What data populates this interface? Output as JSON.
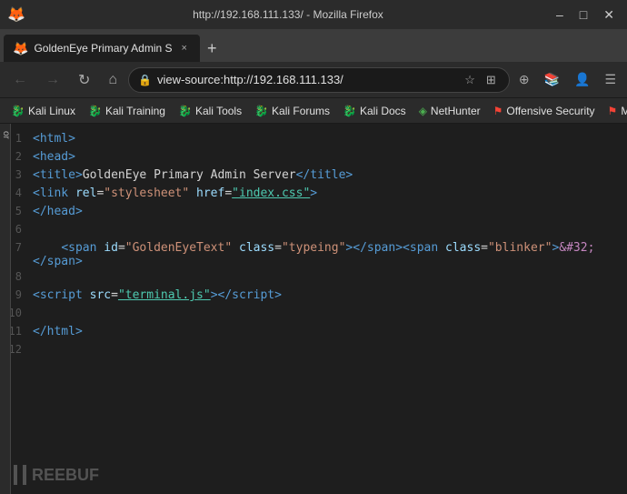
{
  "titlebar": {
    "title": "http://192.168.111.133/ - Mozilla Firefox",
    "controls": [
      "–",
      "□",
      "✕"
    ]
  },
  "tab": {
    "label": "GoldenEye Primary Admin S",
    "url": "http://192.168.111.133/",
    "close": "×"
  },
  "navbar": {
    "url": "view-source:http://192.168.111.133/",
    "lock_icon": "🔒"
  },
  "bookmarks": [
    {
      "label": "Kali Linux",
      "icon": "❊",
      "class": "bookmark-kali"
    },
    {
      "label": "Kali Training",
      "icon": "❊",
      "class": "bookmark-training"
    },
    {
      "label": "Kali Tools",
      "icon": "❊",
      "class": "bookmark-tools"
    },
    {
      "label": "Kali Forums",
      "icon": "❊",
      "class": "bookmark-forums"
    },
    {
      "label": "Kali Docs",
      "icon": "❊",
      "class": "bookmark-docs"
    },
    {
      "label": "NetHunter",
      "icon": "◈",
      "class": "bookmark-nethunter"
    },
    {
      "label": "Offensive Security",
      "icon": "⚑",
      "class": "bookmark-offsec"
    },
    {
      "label": "MSFU",
      "icon": "⚑",
      "class": "bookmark-msfu"
    }
  ],
  "source_lines": [
    {
      "num": "1",
      "html": "<span class='tag'>&lt;html&gt;</span>"
    },
    {
      "num": "2",
      "html": "<span class='tag'>&lt;head&gt;</span>"
    },
    {
      "num": "3",
      "html": "<span class='tag'>&lt;title&gt;</span><span class='text-content'>GoldenEye Primary Admin Server</span><span class='tag'>&lt;/title&gt;</span>"
    },
    {
      "num": "4",
      "html": "<span class='tag'>&lt;link</span> <span class='attr-name'>rel</span>=<span class='attr-value'>\"stylesheet\"</span> <span class='attr-name'>href</span>=<span class='attr-value-link'>\"index.css\"</span><span class='tag'>&gt;</span>"
    },
    {
      "num": "5",
      "html": "<span class='tag'>&lt;/head&gt;</span>"
    },
    {
      "num": "6",
      "html": ""
    },
    {
      "num": "7",
      "html": "&nbsp;&nbsp;&nbsp;&nbsp;<span class='tag'>&lt;span</span> <span class='attr-name'>id</span>=<span class='attr-value'>\"GoldenEyeText\"</span> <span class='attr-name'>class</span>=<span class='attr-value'>\"typeing\"</span><span class='tag'>&gt;&lt;/span&gt;</span><span class='tag'>&lt;span</span> <span class='attr-name'>class</span>=<span class='attr-value'>\"blinker\"</span><span class='tag'>&gt;</span><span class='special'>&amp;#32;</span><span class='tag'>&lt;/span&gt;</span>"
    },
    {
      "num": "8",
      "html": ""
    },
    {
      "num": "9",
      "html": "<span class='tag'>&lt;script</span> <span class='attr-name'>src</span>=<span class='attr-value-link'>\"terminal.js\"</span><span class='tag'>&gt;&lt;/script&gt;</span>"
    },
    {
      "num": "10",
      "html": ""
    },
    {
      "num": "11",
      "html": "<span class='tag'>&lt;/html&gt;</span>"
    },
    {
      "num": "12",
      "html": ""
    }
  ]
}
